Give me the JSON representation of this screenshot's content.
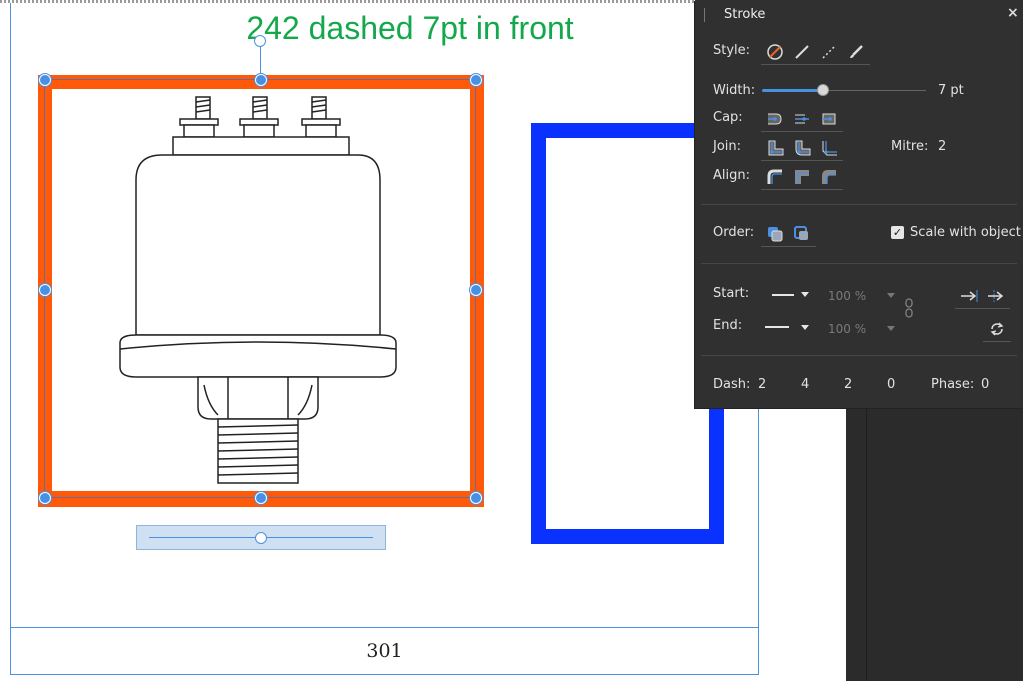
{
  "canvas": {
    "title": "242 dashed 7pt in front",
    "page_number": "301"
  },
  "panel": {
    "title": "Stroke",
    "close_glyph": "×",
    "style_label": "Style:",
    "style_icons": [
      "no-stroke-icon",
      "solid-line-icon",
      "dashed-line-icon",
      "brush-icon"
    ],
    "width_label": "Width:",
    "width_value": "7 pt",
    "width_fraction": 0.37,
    "cap_label": "Cap:",
    "join_label": "Join:",
    "mitre_label": "Mitre:",
    "mitre_value": "2",
    "align_label": "Align:",
    "order_label": "Order:",
    "scale_with_object_label": "Scale with object",
    "scale_with_object_checked": true,
    "start_label": "Start:",
    "start_percent": "100 %",
    "end_label": "End:",
    "end_percent": "100 %",
    "dash_label": "Dash:",
    "dash_values": [
      "2",
      "4",
      "2",
      "0"
    ],
    "phase_label": "Phase:",
    "phase_value": "0"
  },
  "colors": {
    "accent": "#4a90e2",
    "frame_orange": "#ff5a0a",
    "rect_blue": "#0a32ff",
    "title_green": "#12a84b",
    "panel_bg": "#303030"
  }
}
